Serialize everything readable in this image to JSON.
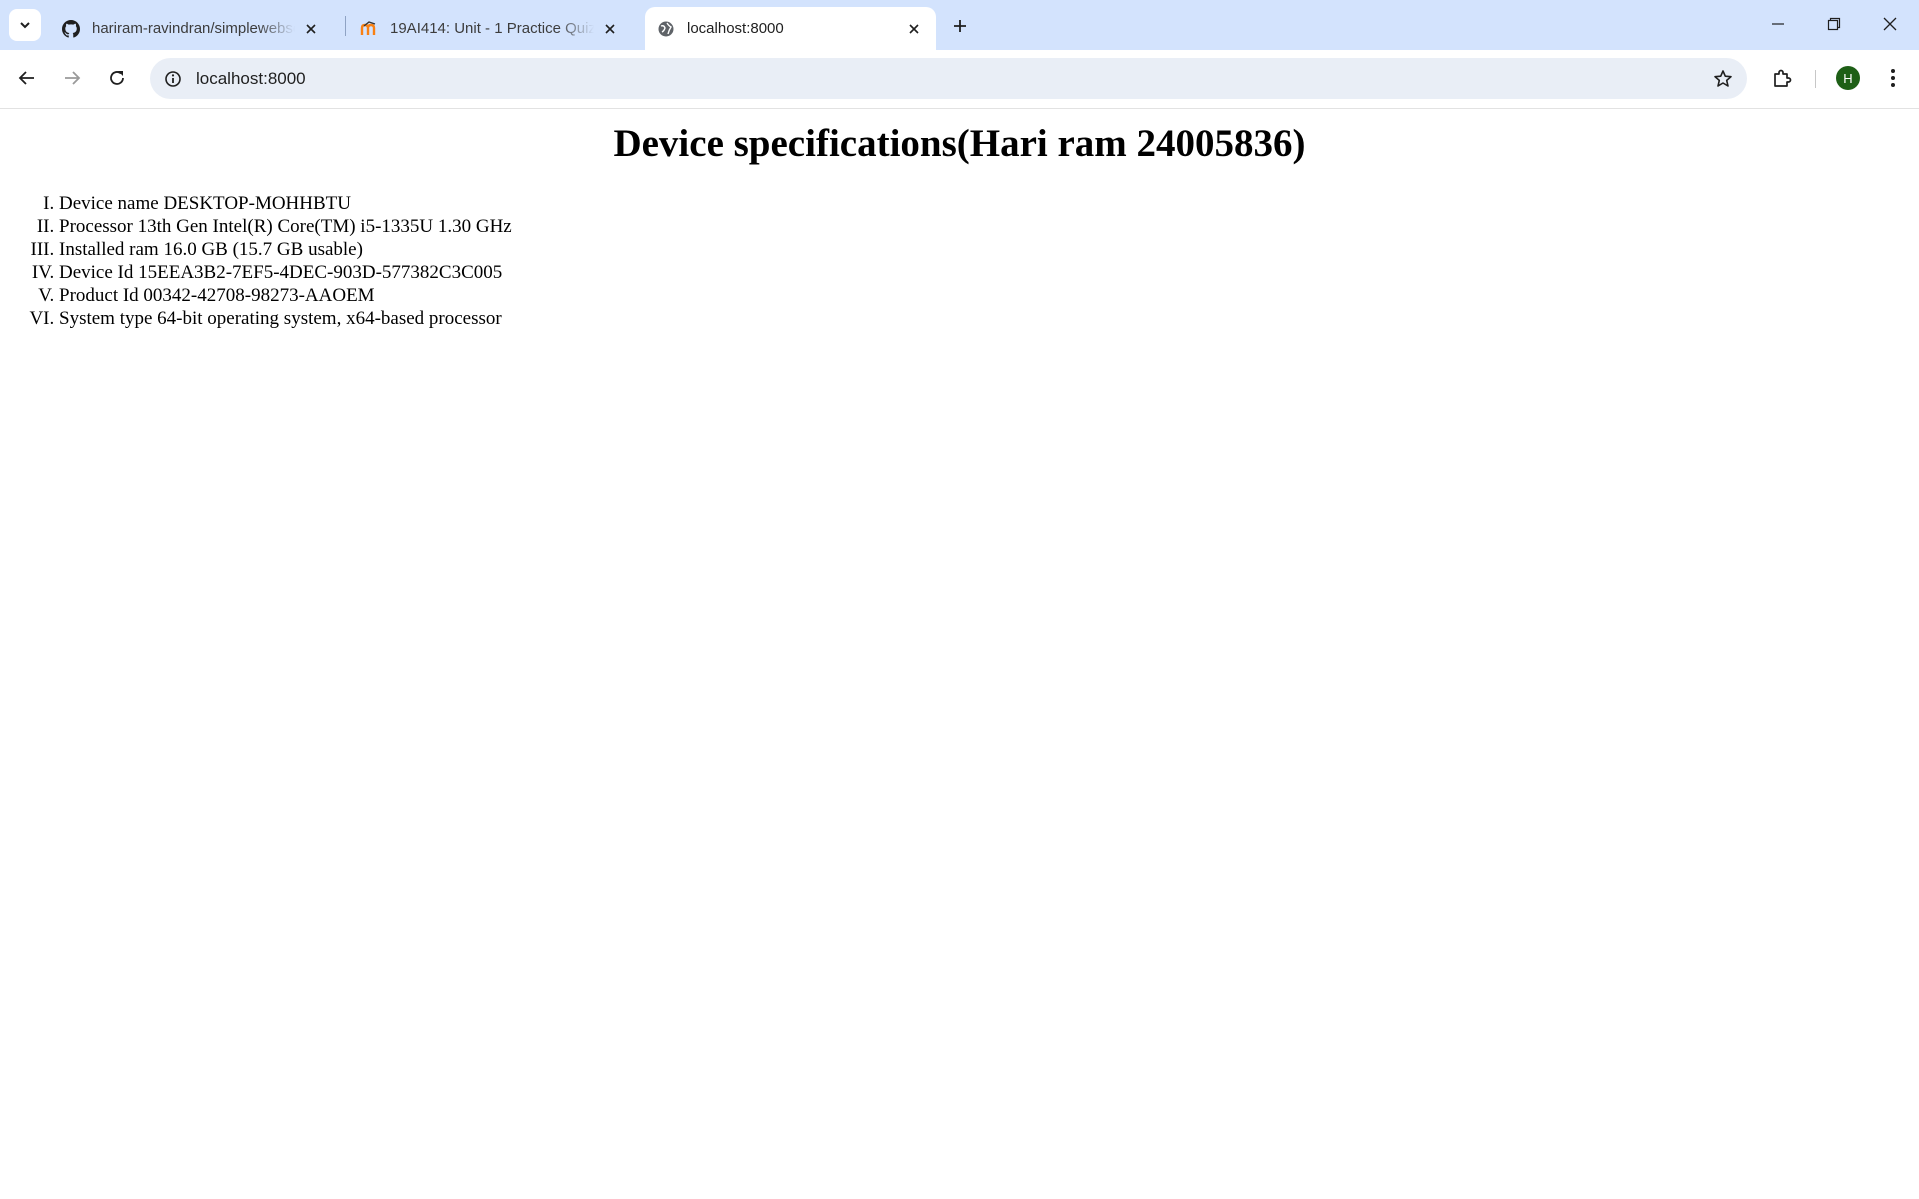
{
  "browser": {
    "tabs": [
      {
        "title": "hariram-ravindran/simplewebserver",
        "icon": "github-icon",
        "active": false
      },
      {
        "title": "19AI414: Unit - 1 Practice Quiz",
        "icon": "moodle-icon",
        "active": false
      },
      {
        "title": "localhost:8000",
        "icon": "globe-icon",
        "active": true
      }
    ],
    "address_bar": {
      "url": "localhost:8000"
    },
    "profile_initial": "H",
    "colors": {
      "tabstrip": "#d3e3fd",
      "omnibox": "#e9eef6",
      "avatar": "#1e5f16"
    }
  },
  "page": {
    "heading": "Device specifications(Hari ram 24005836)",
    "specs": [
      "Device name DESKTOP-MOHHBTU",
      "Processor 13th Gen Intel(R) Core(TM) i5-1335U 1.30 GHz",
      "Installed ram 16.0 GB (15.7 GB usable)",
      "Device Id 15EEA3B2-7EF5-4DEC-903D-577382C3C005",
      "Product Id 00342-42708-98273-AAOEM",
      "System type 64-bit operating system, x64-based processor"
    ]
  }
}
